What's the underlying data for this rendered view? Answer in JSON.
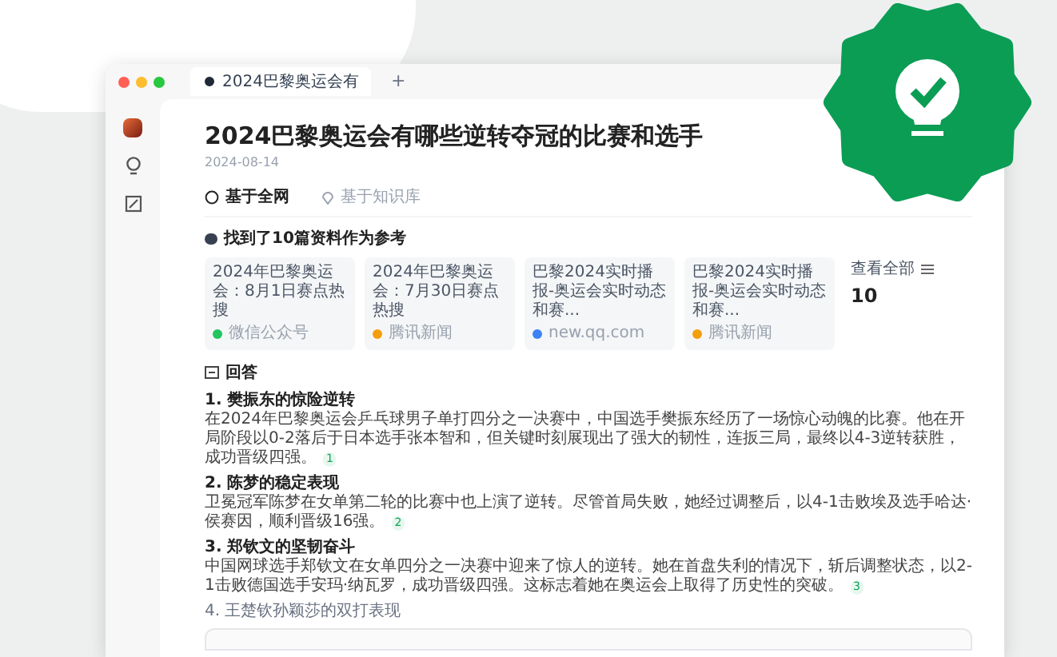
{
  "window": {
    "tab_title": "2024巴黎奥运会有",
    "new_tab": "+"
  },
  "question": {
    "title": "2024巴黎奥运会有哪些逆转夺冠的比赛和选手",
    "date": "2024-08-14"
  },
  "scope_tabs": [
    {
      "label": "基于全网",
      "selected": true
    },
    {
      "label": "基于知识库",
      "selected": false
    }
  ],
  "references": {
    "heading": "找到了10篇资料作为参考",
    "cards": [
      {
        "title": "2024年巴黎奥运会：8月1日赛点热搜",
        "source": "微信公众号",
        "color": "#22c55e"
      },
      {
        "title": "2024年巴黎奥运会：7月30日赛点热搜",
        "source": "腾讯新闻",
        "color": "#f59e0b"
      },
      {
        "title": "巴黎2024实时播报-奥运会实时动态和赛...",
        "source": "new.qq.com",
        "color": "#3b82f6"
      },
      {
        "title": "巴黎2024实时播报-奥运会实时动态和赛...",
        "source": "腾讯新闻",
        "color": "#f59e0b"
      }
    ],
    "view_all": "查看全部",
    "count": "10"
  },
  "answer": {
    "heading": "回答",
    "items": [
      {
        "heading": "1. 樊振东的惊险逆转",
        "text": "在2024年巴黎奥运会乒乓球男子单打四分之一决赛中，中国选手樊振东经历了一场惊心动魄的比赛。他在开局阶段以0-2落后于日本选手张本智和，但关键时刻展现出了强大的韧性，连扳三局，最终以4-3逆转获胜，成功晋级四强。",
        "citation": "1"
      },
      {
        "heading": "2. 陈梦的稳定表现",
        "text": "卫冕冠军陈梦在女单第二轮的比赛中也上演了逆转。尽管首局失败，她经过调整后，以4-1击败埃及选手哈达·侯赛因，顺利晋级16强。",
        "citation": "2"
      },
      {
        "heading": "3. 郑钦文的坚韧奋斗",
        "text": "中国网球选手郑钦文在女单四分之一决赛中迎来了惊人的逆转。她在首盘失利的情况下，斩后调整状态，以2-1击败德国选手安玛·纳瓦罗，成功晋级四强。这标志着她在奥运会上取得了历史性的突破。",
        "citation": "3"
      }
    ],
    "faded_item": "4. 王楚钦孙颖莎的双打表现"
  }
}
